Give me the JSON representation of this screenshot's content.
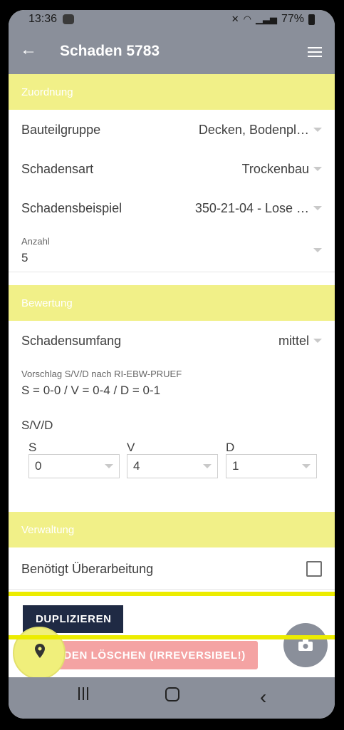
{
  "status_bar": {
    "time": "13:36",
    "battery": "77%"
  },
  "app_bar": {
    "title": "Schaden 5783"
  },
  "sections": {
    "zuordnung": "Zuordnung",
    "bewertung": "Bewertung",
    "verwaltung": "Verwaltung"
  },
  "zuordnung": {
    "bauteilgruppe": {
      "label": "Bauteilgruppe",
      "value": "Decken, Bodenpl…"
    },
    "schadensart": {
      "label": "Schadensart",
      "value": "Trockenbau"
    },
    "schadensbeispiel": {
      "label": "Schadensbeispiel",
      "value": "350-21-04 - Lose …"
    },
    "anzahl": {
      "label": "Anzahl",
      "value": "5"
    }
  },
  "bewertung": {
    "schadensumfang": {
      "label": "Schadensumfang",
      "value": "mittel"
    },
    "vorschlag": {
      "label": "Vorschlag S/V/D nach RI-EBW-PRUEF",
      "value": "S = 0-0 / V = 0-4  / D = 0-1"
    },
    "svd": {
      "title": "S/V/D",
      "s": {
        "label": "S",
        "value": "0"
      },
      "v": {
        "label": "V",
        "value": "4"
      },
      "d": {
        "label": "D",
        "value": "1"
      }
    }
  },
  "verwaltung": {
    "ueberarbeitung": {
      "label": "Benötigt Überarbeitung",
      "checked": false
    }
  },
  "actions": {
    "duplicate_label": "DUPLIZIEREN",
    "delete_label": "ADEN LÖSCHEN (IRREVERSIBEL!)"
  },
  "icons": [
    "arrow-back-icon",
    "menu-icon",
    "map-pin-icon",
    "camera-icon",
    "recent-apps-icon",
    "home-icon",
    "back-icon"
  ],
  "colors": {
    "header": "#8a8f9a",
    "section": "#f1f088",
    "primary_button": "#1f2a44",
    "danger_button": "#f4a3a3",
    "highlight": "#ecec00"
  }
}
